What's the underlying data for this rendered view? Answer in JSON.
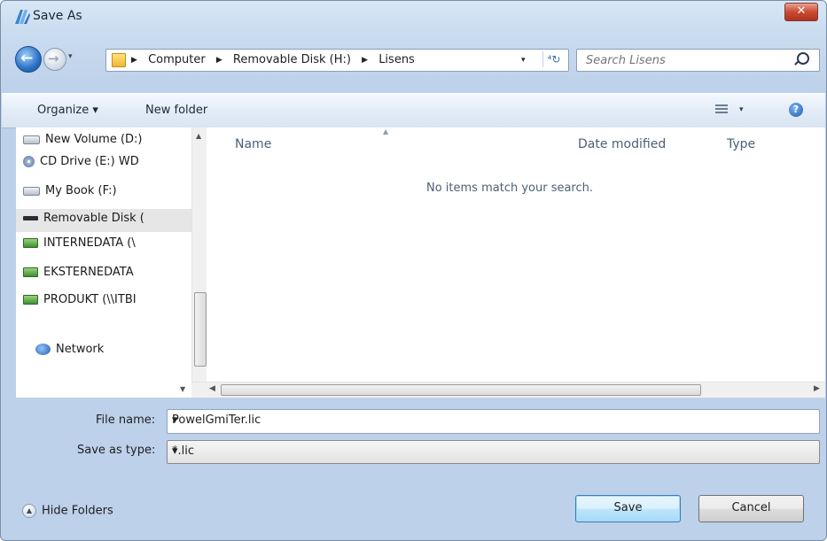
{
  "window": {
    "title": "Save As",
    "close_label": "✕"
  },
  "nav": {
    "back_icon": "back-arrow-icon",
    "forward_icon": "forward-arrow-icon",
    "recent_dropdown": "▾",
    "breadcrumbs": [
      "Computer",
      "Removable Disk (H:)",
      "Lisens"
    ],
    "crumb_separator": "▶",
    "address_dropdown": "▾",
    "refresh_label": "⁴↻",
    "search_placeholder": "Search Lisens"
  },
  "toolbar": {
    "organize": "Organize ▾",
    "new_folder": "New folder",
    "views_dropdown": "▾",
    "help": "?"
  },
  "sidebar": {
    "items": [
      {
        "label": "New Volume (D:)",
        "icon": "hard-drive-icon"
      },
      {
        "label": "CD Drive (E:) WD",
        "icon": "cd-drive-icon"
      },
      {
        "label": "My Book (F:)",
        "icon": "hard-drive-icon"
      },
      {
        "label": "Removable Disk (",
        "icon": "removable-disk-icon",
        "selected": true
      },
      {
        "label": "INTERNEDATA (\\",
        "icon": "network-drive-icon"
      },
      {
        "label": "EKSTERNEDATA",
        "icon": "network-drive-icon"
      },
      {
        "label": "PRODUKT (\\\\ITBI",
        "icon": "network-drive-icon"
      },
      {
        "label": "Network",
        "icon": "network-icon"
      }
    ]
  },
  "file_list": {
    "columns": [
      "Name",
      "Date modified",
      "Type"
    ],
    "sort_indicator": "▲",
    "empty_message": "No items match your search."
  },
  "form": {
    "file_name_label": "File name:",
    "file_name_value": "PowelGmiTer.lic",
    "save_type_label": "Save as type:",
    "save_type_value": "*.lic",
    "dropdown_arrow": "▾"
  },
  "footer": {
    "hide_folders": "Hide Folders",
    "save": "Save",
    "cancel": "Cancel"
  },
  "colors": {
    "accent": "#2b6fc4",
    "window_frame": "#bdd1ea",
    "close_button": "#c94a33"
  }
}
